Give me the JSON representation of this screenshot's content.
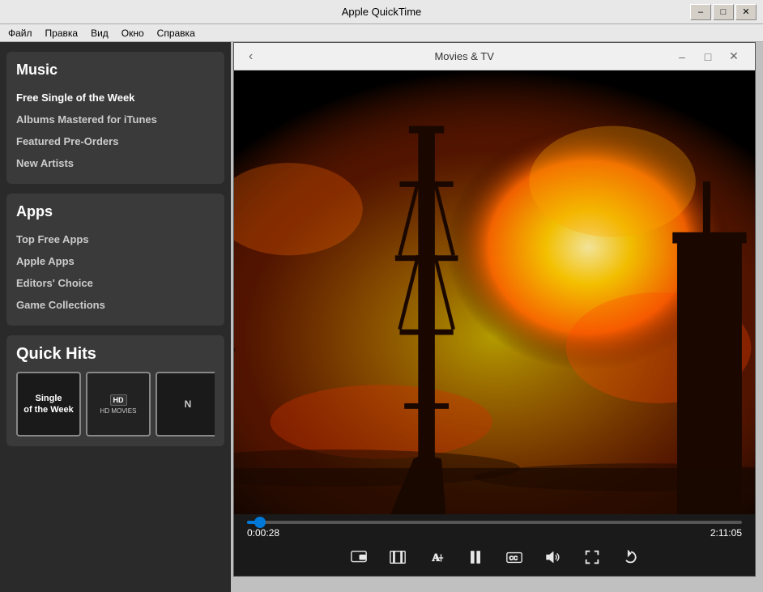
{
  "window": {
    "title": "Apple QuickTime",
    "min_btn": "–",
    "max_btn": "□",
    "close_btn": "✕"
  },
  "menu": {
    "items": [
      "Файл",
      "Правка",
      "Вид",
      "Окно",
      "Справка"
    ]
  },
  "sidebar": {
    "music_section": {
      "title": "Music",
      "items": [
        {
          "label": "Free Single of the Week",
          "highlighted": true
        },
        {
          "label": "Albums Mastered for iTunes"
        },
        {
          "label": "Featured Pre-Orders"
        },
        {
          "label": "New Artists"
        }
      ]
    },
    "apps_section": {
      "title": "Apps",
      "items": [
        {
          "label": "Top Free Apps"
        },
        {
          "label": "Apple Apps"
        },
        {
          "label": "Editors' Choice"
        },
        {
          "label": "Game Collections"
        }
      ]
    },
    "quick_hits": {
      "title": "Quick Hits",
      "items": [
        {
          "type": "single-week",
          "label": "Single of the Week"
        },
        {
          "type": "hd-movies",
          "label": "HD MOVIES"
        },
        {
          "type": "third",
          "label": "N"
        }
      ]
    }
  },
  "video_window": {
    "title": "Movies & TV",
    "back_btn": "‹",
    "min_btn": "–",
    "max_btn": "□",
    "close_btn": "✕",
    "current_time": "0:00:28",
    "total_time": "2:11:05",
    "controls": {
      "loop": "loop",
      "trim": "trim",
      "caption": "A",
      "pause": "pause",
      "cc": "cc",
      "volume": "volume",
      "fullscreen": "fullscreen",
      "replay": "replay"
    }
  }
}
